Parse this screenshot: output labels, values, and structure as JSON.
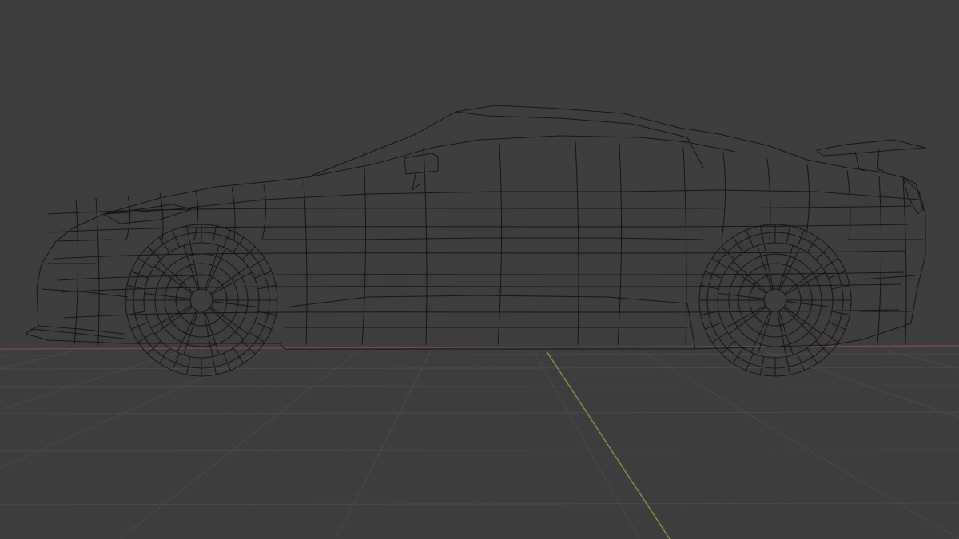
{
  "viewport": {
    "mode": "wireframe",
    "view": "side",
    "background_color": "#3d3d3d",
    "grid_color": "#4a4a4a",
    "x_axis_color": "#7a4a4a",
    "y_axis_color": "#8a9a4a",
    "wire_color": "#151515"
  },
  "scene": {
    "object": "sports-car-mesh",
    "wheels": 2,
    "wheel_spokes": 10,
    "has_rear_wing": true,
    "has_side_mirror": true
  }
}
